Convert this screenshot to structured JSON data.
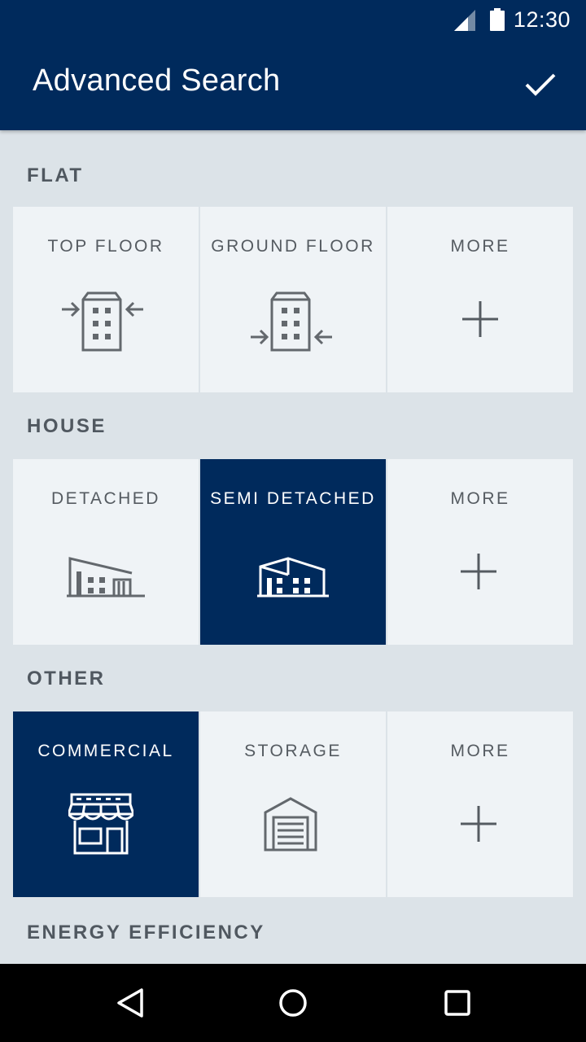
{
  "status_bar": {
    "time": "12:30",
    "icons": [
      "signal-icon",
      "battery-icon"
    ]
  },
  "app_bar": {
    "title": "Advanced Search",
    "confirm_icon": "check-icon"
  },
  "sections": [
    {
      "label": "FLAT",
      "tiles": [
        {
          "label": "TOP FLOOR",
          "icon": "top-floor-icon",
          "selected": false
        },
        {
          "label": "GROUND FLOOR",
          "icon": "ground-floor-icon",
          "selected": false
        },
        {
          "label": "MORE",
          "icon": "plus-icon",
          "selected": false
        }
      ]
    },
    {
      "label": "HOUSE",
      "tiles": [
        {
          "label": "DETACHED",
          "icon": "detached-house-icon",
          "selected": false
        },
        {
          "label": "SEMI DETACHED",
          "icon": "semi-detached-house-icon",
          "selected": true
        },
        {
          "label": "MORE",
          "icon": "plus-icon",
          "selected": false
        }
      ]
    },
    {
      "label": "OTHER",
      "tiles": [
        {
          "label": "COMMERCIAL",
          "icon": "shop-icon",
          "selected": true
        },
        {
          "label": "STORAGE",
          "icon": "garage-icon",
          "selected": false
        },
        {
          "label": "MORE",
          "icon": "plus-icon",
          "selected": false
        }
      ]
    },
    {
      "label": "ENERGY EFFICIENCY",
      "tiles": []
    }
  ],
  "nav_bar": {
    "icons": [
      "back-icon",
      "home-icon",
      "recents-icon"
    ]
  },
  "colors": {
    "primary": "#002a5c",
    "background": "#dce3e8",
    "tile": "#eff3f6",
    "text": "#555b61"
  }
}
